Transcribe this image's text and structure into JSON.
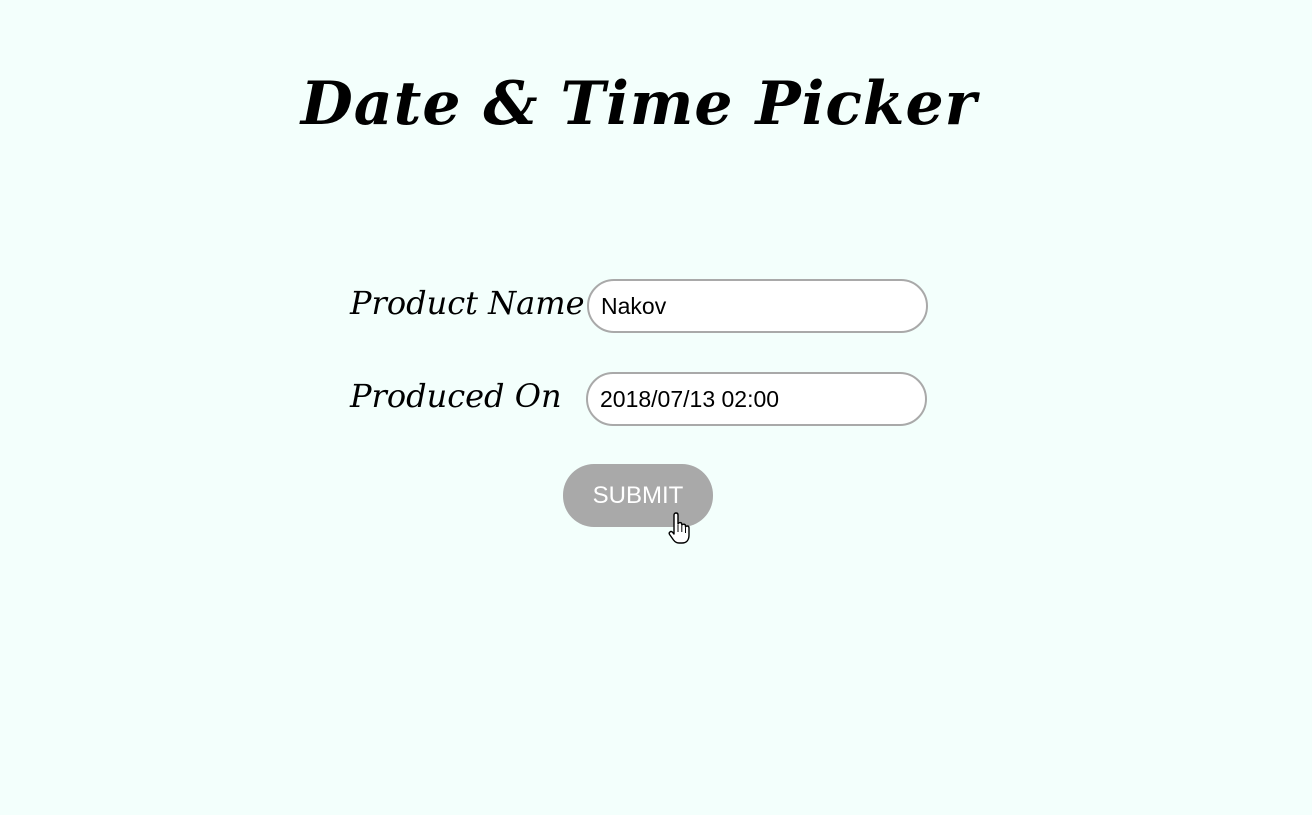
{
  "page": {
    "title": "Date & Time Picker",
    "background_color": "#f3fffc"
  },
  "form": {
    "product_name": {
      "label": "Product Name",
      "value": "Nakov"
    },
    "produced_on": {
      "label": "Produced On",
      "value": "2018/07/13 02:00"
    },
    "submit_label": "SUBMIT",
    "submit_color": "#a9a9a9"
  },
  "cursor": {
    "icon": "hand-pointer-icon"
  }
}
